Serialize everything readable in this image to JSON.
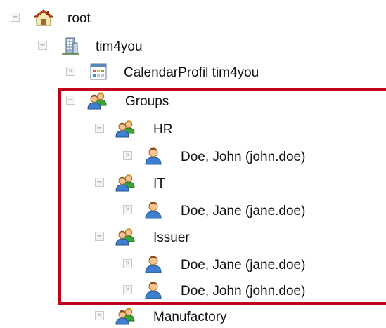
{
  "tree": {
    "highlight_color": "#c0001a",
    "nodes": [
      {
        "label": "root",
        "icon": "home-icon",
        "toggle": "⊟"
      },
      {
        "label": "tim4you",
        "icon": "building-icon",
        "toggle": "⊟"
      },
      {
        "label": "CalendarProfil tim4you",
        "icon": "calendar-icon",
        "toggle": "⊠"
      },
      {
        "label": "Groups",
        "icon": "group-icon",
        "toggle": "⊟"
      },
      {
        "label": "HR",
        "icon": "group-icon",
        "toggle": "⊟"
      },
      {
        "label": "Doe, John (john.doe)",
        "icon": "user-icon",
        "toggle": "⊠"
      },
      {
        "label": "IT",
        "icon": "group-icon",
        "toggle": "⊟"
      },
      {
        "label": "Doe, Jane (jane.doe)",
        "icon": "user-icon",
        "toggle": "⊠"
      },
      {
        "label": "Issuer",
        "icon": "group-icon",
        "toggle": "⊟"
      },
      {
        "label": "Doe, Jane (jane.doe)",
        "icon": "user-icon",
        "toggle": "⊠"
      },
      {
        "label": "Doe, John (john.doe)",
        "icon": "user-icon",
        "toggle": "⊠"
      },
      {
        "label": "Manufactory",
        "icon": "group-icon",
        "toggle": "⊠"
      }
    ]
  }
}
